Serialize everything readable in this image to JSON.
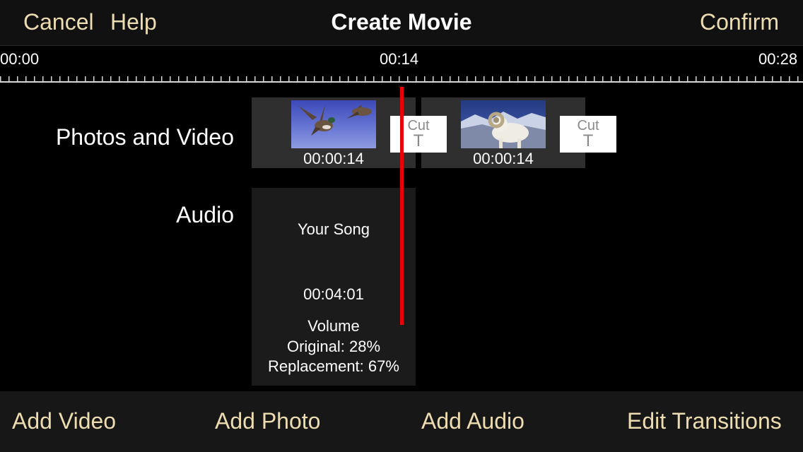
{
  "header": {
    "cancel_label": "Cancel",
    "help_label": "Help",
    "title": "Create Movie",
    "confirm_label": "Confirm"
  },
  "timeline": {
    "ruler_labels": [
      "00:00",
      "00:14",
      "00:28"
    ]
  },
  "tracks": {
    "photos_video_label": "Photos and Video",
    "audio_label": "Audio"
  },
  "clips": [
    {
      "duration": "00:00:14",
      "thumbnail": "flying-ducks-photo",
      "cut_label": "Cut",
      "cut_letter": "T"
    },
    {
      "duration": "00:00:14",
      "thumbnail": "bighorn-ram-photo",
      "cut_label": "Cut",
      "cut_letter": "T"
    }
  ],
  "audio": {
    "song_title": "Your Song",
    "duration": "00:04:01",
    "volume_heading": "Volume",
    "original": "Original: 28%",
    "replacement": "Replacement: 67%"
  },
  "toolbar": {
    "add_video": "Add Video",
    "add_photo": "Add Photo",
    "add_audio": "Add Audio",
    "edit_transitions": "Edit Transitions"
  },
  "colors": {
    "accent": "#ecdcb0",
    "playhead": "#e8000b"
  }
}
